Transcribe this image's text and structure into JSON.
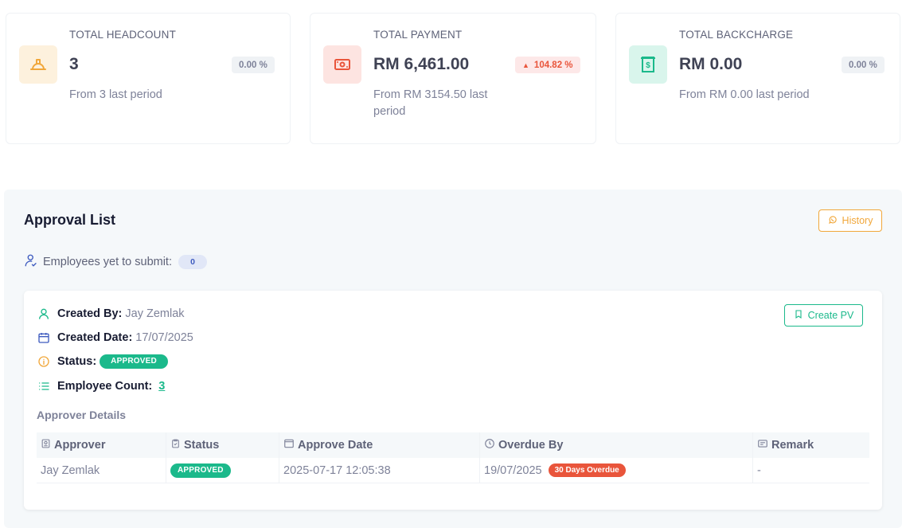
{
  "stats": [
    {
      "label": "TOTAL HEADCOUNT",
      "value": "3",
      "change": "0.00 %",
      "sub": "From 3 last period",
      "icon": "helmet-icon",
      "accent": "#f1a73a"
    },
    {
      "label": "TOTAL PAYMENT",
      "value": "RM 6,461.00",
      "change": "104.82 %",
      "sub": "From RM 3154.50 last period",
      "icon": "money-icon",
      "accent": "#e9553b"
    },
    {
      "label": "TOTAL BACKCHARGE",
      "value": "RM 0.00",
      "change": "0.00 %",
      "sub": "From RM 0.00 last period",
      "icon": "receipt-dollar-icon",
      "accent": "#1bb98b"
    }
  ],
  "approval": {
    "title": "Approval List",
    "history_label": "History",
    "pending_label": "Employees yet to submit:",
    "pending_count": "0",
    "create_pv_label": "Create PV",
    "created_by_label": "Created By:",
    "created_by": "Jay Zemlak",
    "created_date_label": "Created Date:",
    "created_date": "17/07/2025",
    "status_label": "Status:",
    "status": "APPROVED",
    "employee_count_label": "Employee Count:",
    "employee_count": "3",
    "approver_details_title": "Approver Details",
    "columns": [
      "Approver",
      "Status",
      "Approve Date",
      "Overdue By",
      "Remark"
    ],
    "rows": [
      {
        "approver": "Jay Zemlak",
        "status": "APPROVED",
        "approve_date": "2025-07-17 12:05:38",
        "overdue_by": "19/07/2025",
        "overdue_badge": "30 Days Overdue",
        "remark": "-"
      }
    ]
  },
  "colors": {
    "primary": "#1bb98b",
    "warning": "#f1a73a",
    "danger": "#e9553b",
    "muted": "#7e8299"
  }
}
